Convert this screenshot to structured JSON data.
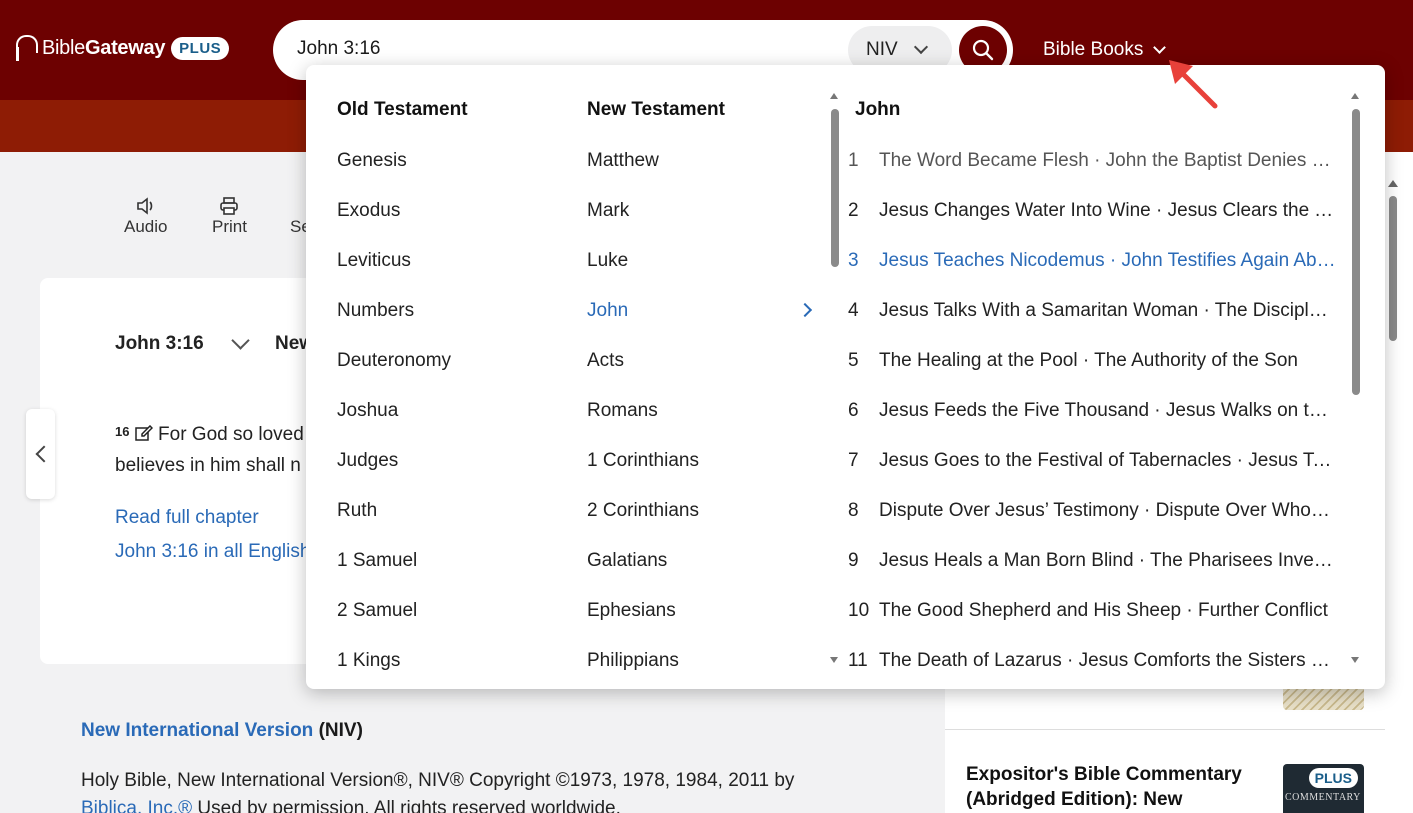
{
  "header": {
    "logo_text_light": "Bible",
    "logo_text_bold": "Gateway",
    "logo_plus": "PLUS",
    "search_value": "John 3:16",
    "version": "NIV",
    "bible_books_label": "Bible Books"
  },
  "toolbar": {
    "audio_label": "Audio",
    "print_label": "Print",
    "partial_label": "Se"
  },
  "passage": {
    "reference": "John 3:16",
    "version_partial": "New",
    "verse_number": "16",
    "verse_text_line1": "For God so loved",
    "verse_text_line2": "believes in him shall n",
    "read_full_chapter": "Read full chapter",
    "all_english": "John 3:16 in all English"
  },
  "footer": {
    "version_link": "New International Version",
    "version_abbr": "(NIV)",
    "copyright_line1": "Holy Bible, New International Version®, NIV® Copyright ©1973, 1978, 1984, 2011 by",
    "copyright_link": "Biblica, Inc.®",
    "copyright_line2": " Used by permission. All rights reserved worldwide."
  },
  "sidebar": {
    "commentary_title": "Expositor's Bible Commentary (Abridged Edition): New",
    "commentary_plus": "PLUS",
    "commentary_cover_text": "COMMENTARY"
  },
  "dropdown": {
    "old_testament_heading": "Old Testament",
    "new_testament_heading": "New Testament",
    "chapters_heading": "John",
    "old_testament": [
      "Genesis",
      "Exodus",
      "Leviticus",
      "Numbers",
      "Deuteronomy",
      "Joshua",
      "Judges",
      "Ruth",
      "1 Samuel",
      "2 Samuel",
      "1 Kings"
    ],
    "new_testament": [
      "Matthew",
      "Mark",
      "Luke",
      "John",
      "Acts",
      "Romans",
      "1 Corinthians",
      "2 Corinthians",
      "Galatians",
      "Ephesians",
      "Philippians"
    ],
    "selected_book": "John",
    "chapters": [
      {
        "num": "1",
        "title": "The Word Became Flesh · John the Baptist Denies Being the Messiah"
      },
      {
        "num": "2",
        "title": "Jesus Changes Water Into Wine · Jesus Clears the Temple Courts"
      },
      {
        "num": "3",
        "title": "Jesus Teaches Nicodemus · John Testifies Again About Jesus"
      },
      {
        "num": "4",
        "title": "Jesus Talks With a Samaritan Woman · The Disciples Rejoined"
      },
      {
        "num": "5",
        "title": "The Healing at the Pool · The Authority of the Son"
      },
      {
        "num": "6",
        "title": "Jesus Feeds the Five Thousand · Jesus Walks on the Water"
      },
      {
        "num": "7",
        "title": "Jesus Goes to the Festival of Tabernacles · Jesus Teaches"
      },
      {
        "num": "8",
        "title": "Dispute Over Jesus’ Testimony · Dispute Over Whose Children"
      },
      {
        "num": "9",
        "title": "Jesus Heals a Man Born Blind · The Pharisees Investigate"
      },
      {
        "num": "10",
        "title": "The Good Shepherd and His Sheep · Further Conflict"
      },
      {
        "num": "11",
        "title": "The Death of Lazarus · Jesus Comforts the Sisters of Lazarus"
      }
    ]
  },
  "colors": {
    "header_bg": "#6d0101",
    "subbar_bg": "#8e1c05",
    "link": "#2a6ab7",
    "arrow": "#e8413a"
  }
}
